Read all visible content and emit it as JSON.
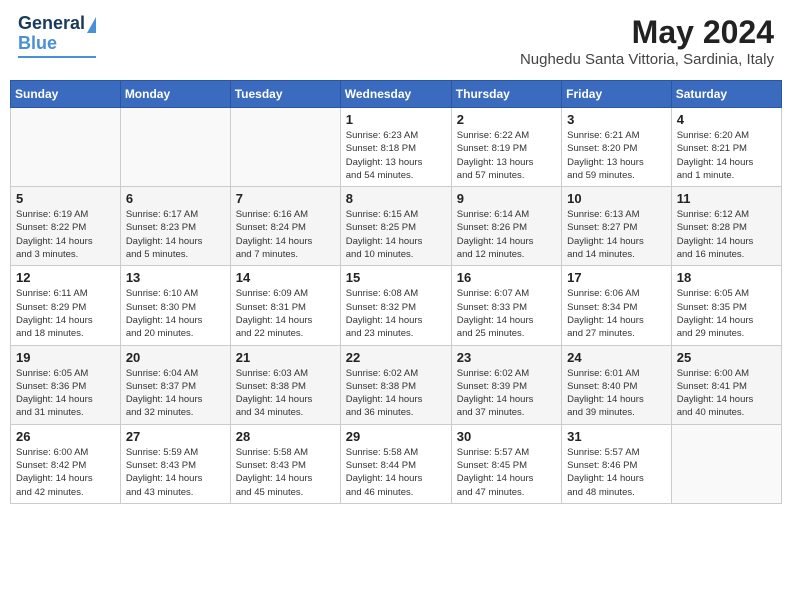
{
  "logo": {
    "line1": "General",
    "line2": "Blue"
  },
  "title": "May 2024",
  "location": "Nughedu Santa Vittoria, Sardinia, Italy",
  "days_header": [
    "Sunday",
    "Monday",
    "Tuesday",
    "Wednesday",
    "Thursday",
    "Friday",
    "Saturday"
  ],
  "weeks": [
    [
      {
        "day": "",
        "detail": ""
      },
      {
        "day": "",
        "detail": ""
      },
      {
        "day": "",
        "detail": ""
      },
      {
        "day": "1",
        "detail": "Sunrise: 6:23 AM\nSunset: 8:18 PM\nDaylight: 13 hours\nand 54 minutes."
      },
      {
        "day": "2",
        "detail": "Sunrise: 6:22 AM\nSunset: 8:19 PM\nDaylight: 13 hours\nand 57 minutes."
      },
      {
        "day": "3",
        "detail": "Sunrise: 6:21 AM\nSunset: 8:20 PM\nDaylight: 13 hours\nand 59 minutes."
      },
      {
        "day": "4",
        "detail": "Sunrise: 6:20 AM\nSunset: 8:21 PM\nDaylight: 14 hours\nand 1 minute."
      }
    ],
    [
      {
        "day": "5",
        "detail": "Sunrise: 6:19 AM\nSunset: 8:22 PM\nDaylight: 14 hours\nand 3 minutes."
      },
      {
        "day": "6",
        "detail": "Sunrise: 6:17 AM\nSunset: 8:23 PM\nDaylight: 14 hours\nand 5 minutes."
      },
      {
        "day": "7",
        "detail": "Sunrise: 6:16 AM\nSunset: 8:24 PM\nDaylight: 14 hours\nand 7 minutes."
      },
      {
        "day": "8",
        "detail": "Sunrise: 6:15 AM\nSunset: 8:25 PM\nDaylight: 14 hours\nand 10 minutes."
      },
      {
        "day": "9",
        "detail": "Sunrise: 6:14 AM\nSunset: 8:26 PM\nDaylight: 14 hours\nand 12 minutes."
      },
      {
        "day": "10",
        "detail": "Sunrise: 6:13 AM\nSunset: 8:27 PM\nDaylight: 14 hours\nand 14 minutes."
      },
      {
        "day": "11",
        "detail": "Sunrise: 6:12 AM\nSunset: 8:28 PM\nDaylight: 14 hours\nand 16 minutes."
      }
    ],
    [
      {
        "day": "12",
        "detail": "Sunrise: 6:11 AM\nSunset: 8:29 PM\nDaylight: 14 hours\nand 18 minutes."
      },
      {
        "day": "13",
        "detail": "Sunrise: 6:10 AM\nSunset: 8:30 PM\nDaylight: 14 hours\nand 20 minutes."
      },
      {
        "day": "14",
        "detail": "Sunrise: 6:09 AM\nSunset: 8:31 PM\nDaylight: 14 hours\nand 22 minutes."
      },
      {
        "day": "15",
        "detail": "Sunrise: 6:08 AM\nSunset: 8:32 PM\nDaylight: 14 hours\nand 23 minutes."
      },
      {
        "day": "16",
        "detail": "Sunrise: 6:07 AM\nSunset: 8:33 PM\nDaylight: 14 hours\nand 25 minutes."
      },
      {
        "day": "17",
        "detail": "Sunrise: 6:06 AM\nSunset: 8:34 PM\nDaylight: 14 hours\nand 27 minutes."
      },
      {
        "day": "18",
        "detail": "Sunrise: 6:05 AM\nSunset: 8:35 PM\nDaylight: 14 hours\nand 29 minutes."
      }
    ],
    [
      {
        "day": "19",
        "detail": "Sunrise: 6:05 AM\nSunset: 8:36 PM\nDaylight: 14 hours\nand 31 minutes."
      },
      {
        "day": "20",
        "detail": "Sunrise: 6:04 AM\nSunset: 8:37 PM\nDaylight: 14 hours\nand 32 minutes."
      },
      {
        "day": "21",
        "detail": "Sunrise: 6:03 AM\nSunset: 8:38 PM\nDaylight: 14 hours\nand 34 minutes."
      },
      {
        "day": "22",
        "detail": "Sunrise: 6:02 AM\nSunset: 8:38 PM\nDaylight: 14 hours\nand 36 minutes."
      },
      {
        "day": "23",
        "detail": "Sunrise: 6:02 AM\nSunset: 8:39 PM\nDaylight: 14 hours\nand 37 minutes."
      },
      {
        "day": "24",
        "detail": "Sunrise: 6:01 AM\nSunset: 8:40 PM\nDaylight: 14 hours\nand 39 minutes."
      },
      {
        "day": "25",
        "detail": "Sunrise: 6:00 AM\nSunset: 8:41 PM\nDaylight: 14 hours\nand 40 minutes."
      }
    ],
    [
      {
        "day": "26",
        "detail": "Sunrise: 6:00 AM\nSunset: 8:42 PM\nDaylight: 14 hours\nand 42 minutes."
      },
      {
        "day": "27",
        "detail": "Sunrise: 5:59 AM\nSunset: 8:43 PM\nDaylight: 14 hours\nand 43 minutes."
      },
      {
        "day": "28",
        "detail": "Sunrise: 5:58 AM\nSunset: 8:43 PM\nDaylight: 14 hours\nand 45 minutes."
      },
      {
        "day": "29",
        "detail": "Sunrise: 5:58 AM\nSunset: 8:44 PM\nDaylight: 14 hours\nand 46 minutes."
      },
      {
        "day": "30",
        "detail": "Sunrise: 5:57 AM\nSunset: 8:45 PM\nDaylight: 14 hours\nand 47 minutes."
      },
      {
        "day": "31",
        "detail": "Sunrise: 5:57 AM\nSunset: 8:46 PM\nDaylight: 14 hours\nand 48 minutes."
      },
      {
        "day": "",
        "detail": ""
      }
    ]
  ]
}
